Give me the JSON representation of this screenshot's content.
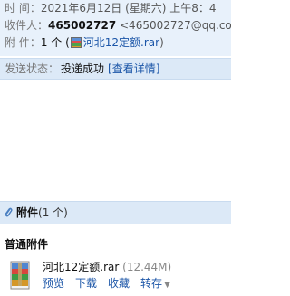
{
  "header": {
    "time_label": "时    间：",
    "time_value": "2021年6月12日 (星期六) 上午8：4",
    "to_label": "收件人：",
    "to_name": "465002727",
    "to_email": "<465002727@qq.cor",
    "att_label": "附    件：",
    "att_count": "1 个 (",
    "att_file": "河北12定额.rar",
    "att_close": ")"
  },
  "status": {
    "label": "发送状态：",
    "value": "投递成功",
    "link": "[查看详情]"
  },
  "attachments_bar": {
    "title": "附件",
    "count": "(1 个)"
  },
  "section": {
    "title": "普通附件"
  },
  "file": {
    "name": "河北12定额.rar",
    "size": "(12.44M)",
    "actions": [
      "预览",
      "下载",
      "收藏",
      "转存"
    ]
  }
}
